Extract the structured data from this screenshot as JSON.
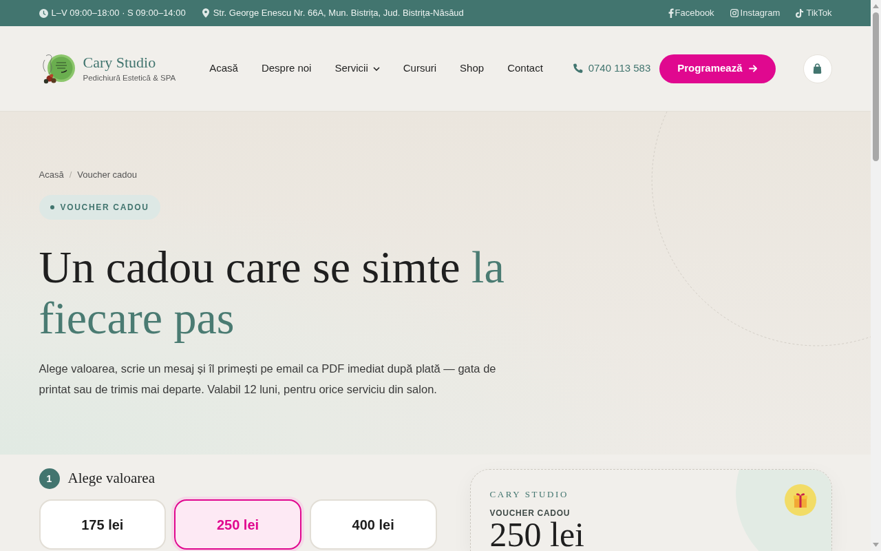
{
  "top_bar": {
    "hours": "L–V 09:00–18:00 · S 09:00–14:00",
    "address": "Str. George Enescu Nr. 66A, Mun. Bistrița, Jud. Bistrița-Năsăud",
    "social_links": [
      {
        "kind": "facebook",
        "label": "Facebook"
      },
      {
        "kind": "instagram",
        "label": "Instagram"
      },
      {
        "kind": "tiktok",
        "label": "TikTok"
      }
    ]
  },
  "header": {
    "brand": {
      "name": "Cary Studio",
      "tagline": "Pedichiură Estetică & SPA"
    },
    "nav": [
      {
        "label": "Acasă",
        "has_dropdown": false
      },
      {
        "label": "Despre noi",
        "has_dropdown": false
      },
      {
        "label": "Servicii",
        "has_dropdown": true
      },
      {
        "label": "Cursuri",
        "has_dropdown": false
      },
      {
        "label": "Shop",
        "has_dropdown": false
      },
      {
        "label": "Contact",
        "has_dropdown": false
      }
    ],
    "phone": "0740 113 583",
    "cta": "Programează"
  },
  "hero": {
    "breadcrumb": {
      "items": [
        "Acasă",
        "Voucher cadou"
      ],
      "separator": "/"
    },
    "badge": "VOUCHER CADOU",
    "heading": {
      "text": "Un cadou care se simte",
      "accent": "la fiecare pas"
    },
    "description": "Alege valoarea, scrie un mesaj și îl primești pe email ca PDF imediat după plată — gata de printat sau de trimis mai departe. Valabil 12 luni, pentru orice serviciu din salon."
  },
  "value_step": {
    "number": "1",
    "title": "Alege valoarea",
    "amounts": [
      {
        "label": "175 lei",
        "selected": false
      },
      {
        "label": "250 lei",
        "selected": true
      },
      {
        "label": "400 lei",
        "selected": false
      }
    ]
  },
  "voucher_preview": {
    "brand": "CARY STUDIO",
    "label": "VOUCHER CADOU",
    "amount": "250 lei"
  }
}
